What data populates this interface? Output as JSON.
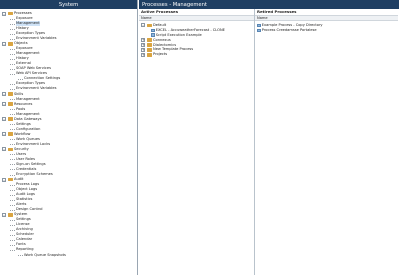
{
  "left": {
    "title": "System",
    "tree": [
      {
        "label": "Processes",
        "level": 0,
        "expander": "–"
      },
      {
        "label": "Exposure",
        "level": 1
      },
      {
        "label": "Management",
        "level": 1,
        "selected": true
      },
      {
        "label": "History",
        "level": 1
      },
      {
        "label": "Exception Types",
        "level": 1
      },
      {
        "label": "Environment Variables",
        "level": 1
      },
      {
        "label": "Objects",
        "level": 0,
        "expander": "–"
      },
      {
        "label": "Exposure",
        "level": 1
      },
      {
        "label": "Management",
        "level": 1
      },
      {
        "label": "History",
        "level": 1
      },
      {
        "label": "External",
        "level": 1
      },
      {
        "label": "SOAP Web Services",
        "level": 1
      },
      {
        "label": "Web API Services",
        "level": 1
      },
      {
        "label": "Connection Settings",
        "level": 2
      },
      {
        "label": "Exception Types",
        "level": 1
      },
      {
        "label": "Environment Variables",
        "level": 1
      },
      {
        "label": "Skills",
        "level": 0,
        "expander": "–"
      },
      {
        "label": "Management",
        "level": 1
      },
      {
        "label": "Resources",
        "level": 0,
        "expander": "–"
      },
      {
        "label": "Pools",
        "level": 1
      },
      {
        "label": "Management",
        "level": 1
      },
      {
        "label": "Data Gateways",
        "level": 0,
        "expander": "–"
      },
      {
        "label": "Settings",
        "level": 1
      },
      {
        "label": "Configuration",
        "level": 1
      },
      {
        "label": "Workflow",
        "level": 0,
        "expander": "–"
      },
      {
        "label": "Work Queues",
        "level": 1
      },
      {
        "label": "Environment Locks",
        "level": 1
      },
      {
        "label": "Security",
        "level": 0,
        "expander": "–"
      },
      {
        "label": "Users",
        "level": 1
      },
      {
        "label": "User Roles",
        "level": 1
      },
      {
        "label": "Sign-on Settings",
        "level": 1
      },
      {
        "label": "Credentials",
        "level": 1
      },
      {
        "label": "Encryption Schemes",
        "level": 1
      },
      {
        "label": "Audit",
        "level": 0,
        "expander": "–"
      },
      {
        "label": "Process Logs",
        "level": 1
      },
      {
        "label": "Object Logs",
        "level": 1
      },
      {
        "label": "Audit Logs",
        "level": 1
      },
      {
        "label": "Statistics",
        "level": 1
      },
      {
        "label": "Alerts",
        "level": 1
      },
      {
        "label": "Design Control",
        "level": 1
      },
      {
        "label": "System",
        "level": 0,
        "expander": "–"
      },
      {
        "label": "Settings",
        "level": 1
      },
      {
        "label": "License",
        "level": 1
      },
      {
        "label": "Archiving",
        "level": 1
      },
      {
        "label": "Scheduler",
        "level": 1
      },
      {
        "label": "Calendar",
        "level": 1
      },
      {
        "label": "Fonts",
        "level": 1
      },
      {
        "label": "Reporting",
        "level": 1
      },
      {
        "label": "Work Queue Snapshots",
        "level": 2
      }
    ]
  },
  "right": {
    "title": "Processes - Management",
    "active": {
      "title": "Active Processes",
      "column_header": "Name",
      "rows": [
        {
          "label": "Default",
          "kind": "group",
          "expander": "–"
        },
        {
          "label": "EXCEL - AccuweatherForecast - CLONE",
          "kind": "item"
        },
        {
          "label": "Script Execution Example",
          "kind": "item"
        },
        {
          "label": "Connexus",
          "kind": "group",
          "expander": "+"
        },
        {
          "label": "Dialectomics",
          "kind": "group",
          "expander": "+"
        },
        {
          "label": "New Template Process",
          "kind": "group",
          "expander": "+"
        },
        {
          "label": "Projects",
          "kind": "group",
          "expander": "+"
        }
      ]
    },
    "retired": {
      "title": "Retired Processes",
      "column_header": "Name",
      "rows": [
        {
          "label": "Example Process - Copy Directory"
        },
        {
          "label": "Process Creedamsse Portalese"
        }
      ]
    }
  },
  "colors": {
    "header_bg": "#1f3f63",
    "selected_bg": "#cfe3f7",
    "folder": "#d9a441"
  }
}
